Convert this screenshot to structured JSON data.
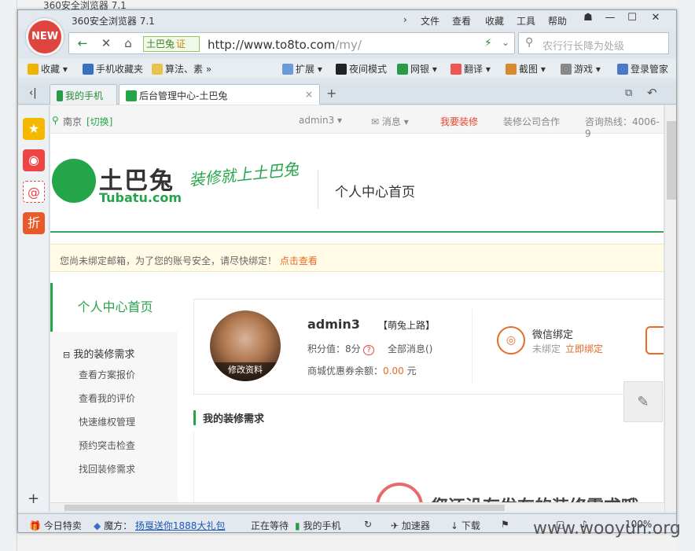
{
  "bg": {
    "title": "360安全浏览器 7.1"
  },
  "window": {
    "title": "360安全浏览器 7.1",
    "menu": [
      "文件",
      "查看",
      "收藏",
      "工具",
      "帮助"
    ],
    "controls": {
      "skin": "☗",
      "min": "—",
      "max": "☐",
      "close": "✕"
    }
  },
  "newlogo": "NEW",
  "address": {
    "site_id": "土巴兔",
    "cert": "证",
    "url_host": "http://www.to8to.com",
    "url_path": "/my/",
    "search_placeholder": "农行行长降为处级"
  },
  "bookmarks": [
    "收藏",
    "手机收藏夹",
    "算法、素",
    "扩展",
    "夜间模式",
    "网银",
    "翻译",
    "截图",
    "游戏",
    "登录管家"
  ],
  "tabs": {
    "items": [
      {
        "label": "我的手机"
      },
      {
        "label": "后台管理中心-土巴兔"
      }
    ],
    "add": "+"
  },
  "site": {
    "topbar": {
      "city": "南京",
      "switch": "[切换]",
      "user": "admin3",
      "msg": "消息",
      "deco": "我要装修",
      "coop": "装修公司合作",
      "hotline": "咨询热线：4006-9"
    },
    "brand": "土巴兔",
    "brand_en": "Tubatu.com",
    "slogan": "装修就上土巴兔",
    "page_title": "个人中心首页",
    "notice": {
      "text": "您尚未绑定邮箱，为了您的账号安全，请尽快绑定！",
      "link": "点击查看"
    },
    "leftnav": {
      "home": "个人中心首页",
      "section": "我的装修需求",
      "items": [
        "查看方案报价",
        "查看我的评价",
        "快速维权管理",
        "预约突击检查",
        "找回装修需求"
      ]
    },
    "profile": {
      "edit": "修改资料",
      "name": "admin3",
      "level": "【萌兔上路】",
      "points": "积分值：8分",
      "msg": "全部消息()",
      "coupon_label": "商城优惠券余额：",
      "coupon_value": "0.00",
      "coupon_unit": "元",
      "wx_title": "微信绑定",
      "wx_status": "未绑定",
      "wx_link": "立即绑定"
    },
    "section_title": "我的装修需求",
    "empty_text": "您还没有发布的装修需求哦"
  },
  "status": {
    "today": "今日特卖",
    "mofang": "魔方：",
    "promo": "扬戛送你1888大礼包",
    "waiting": "正在等待",
    "phone": "我的手机",
    "accel": "加速器",
    "download": "下载",
    "zoom": "100%"
  },
  "watermark": "www.wooyun.org"
}
